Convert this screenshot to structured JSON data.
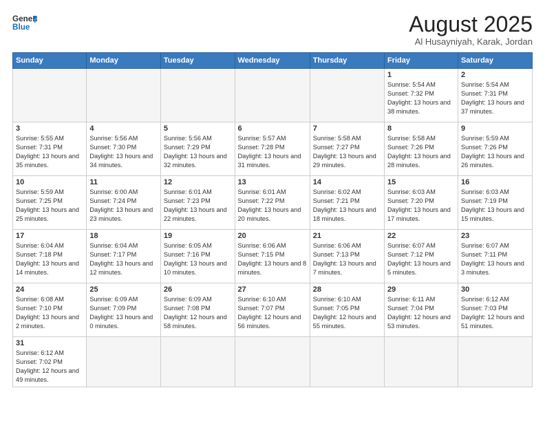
{
  "logo": {
    "line1": "General",
    "line2": "Blue"
  },
  "title": "August 2025",
  "subtitle": "Al Husayniyah, Karak, Jordan",
  "days_of_week": [
    "Sunday",
    "Monday",
    "Tuesday",
    "Wednesday",
    "Thursday",
    "Friday",
    "Saturday"
  ],
  "weeks": [
    [
      {
        "day": "",
        "info": ""
      },
      {
        "day": "",
        "info": ""
      },
      {
        "day": "",
        "info": ""
      },
      {
        "day": "",
        "info": ""
      },
      {
        "day": "",
        "info": ""
      },
      {
        "day": "1",
        "info": "Sunrise: 5:54 AM\nSunset: 7:32 PM\nDaylight: 13 hours and 38 minutes."
      },
      {
        "day": "2",
        "info": "Sunrise: 5:54 AM\nSunset: 7:31 PM\nDaylight: 13 hours and 37 minutes."
      }
    ],
    [
      {
        "day": "3",
        "info": "Sunrise: 5:55 AM\nSunset: 7:31 PM\nDaylight: 13 hours and 35 minutes."
      },
      {
        "day": "4",
        "info": "Sunrise: 5:56 AM\nSunset: 7:30 PM\nDaylight: 13 hours and 34 minutes."
      },
      {
        "day": "5",
        "info": "Sunrise: 5:56 AM\nSunset: 7:29 PM\nDaylight: 13 hours and 32 minutes."
      },
      {
        "day": "6",
        "info": "Sunrise: 5:57 AM\nSunset: 7:28 PM\nDaylight: 13 hours and 31 minutes."
      },
      {
        "day": "7",
        "info": "Sunrise: 5:58 AM\nSunset: 7:27 PM\nDaylight: 13 hours and 29 minutes."
      },
      {
        "day": "8",
        "info": "Sunrise: 5:58 AM\nSunset: 7:26 PM\nDaylight: 13 hours and 28 minutes."
      },
      {
        "day": "9",
        "info": "Sunrise: 5:59 AM\nSunset: 7:26 PM\nDaylight: 13 hours and 26 minutes."
      }
    ],
    [
      {
        "day": "10",
        "info": "Sunrise: 5:59 AM\nSunset: 7:25 PM\nDaylight: 13 hours and 25 minutes."
      },
      {
        "day": "11",
        "info": "Sunrise: 6:00 AM\nSunset: 7:24 PM\nDaylight: 13 hours and 23 minutes."
      },
      {
        "day": "12",
        "info": "Sunrise: 6:01 AM\nSunset: 7:23 PM\nDaylight: 13 hours and 22 minutes."
      },
      {
        "day": "13",
        "info": "Sunrise: 6:01 AM\nSunset: 7:22 PM\nDaylight: 13 hours and 20 minutes."
      },
      {
        "day": "14",
        "info": "Sunrise: 6:02 AM\nSunset: 7:21 PM\nDaylight: 13 hours and 18 minutes."
      },
      {
        "day": "15",
        "info": "Sunrise: 6:03 AM\nSunset: 7:20 PM\nDaylight: 13 hours and 17 minutes."
      },
      {
        "day": "16",
        "info": "Sunrise: 6:03 AM\nSunset: 7:19 PM\nDaylight: 13 hours and 15 minutes."
      }
    ],
    [
      {
        "day": "17",
        "info": "Sunrise: 6:04 AM\nSunset: 7:18 PM\nDaylight: 13 hours and 14 minutes."
      },
      {
        "day": "18",
        "info": "Sunrise: 6:04 AM\nSunset: 7:17 PM\nDaylight: 13 hours and 12 minutes."
      },
      {
        "day": "19",
        "info": "Sunrise: 6:05 AM\nSunset: 7:16 PM\nDaylight: 13 hours and 10 minutes."
      },
      {
        "day": "20",
        "info": "Sunrise: 6:06 AM\nSunset: 7:15 PM\nDaylight: 13 hours and 8 minutes."
      },
      {
        "day": "21",
        "info": "Sunrise: 6:06 AM\nSunset: 7:13 PM\nDaylight: 13 hours and 7 minutes."
      },
      {
        "day": "22",
        "info": "Sunrise: 6:07 AM\nSunset: 7:12 PM\nDaylight: 13 hours and 5 minutes."
      },
      {
        "day": "23",
        "info": "Sunrise: 6:07 AM\nSunset: 7:11 PM\nDaylight: 13 hours and 3 minutes."
      }
    ],
    [
      {
        "day": "24",
        "info": "Sunrise: 6:08 AM\nSunset: 7:10 PM\nDaylight: 13 hours and 2 minutes."
      },
      {
        "day": "25",
        "info": "Sunrise: 6:09 AM\nSunset: 7:09 PM\nDaylight: 13 hours and 0 minutes."
      },
      {
        "day": "26",
        "info": "Sunrise: 6:09 AM\nSunset: 7:08 PM\nDaylight: 12 hours and 58 minutes."
      },
      {
        "day": "27",
        "info": "Sunrise: 6:10 AM\nSunset: 7:07 PM\nDaylight: 12 hours and 56 minutes."
      },
      {
        "day": "28",
        "info": "Sunrise: 6:10 AM\nSunset: 7:05 PM\nDaylight: 12 hours and 55 minutes."
      },
      {
        "day": "29",
        "info": "Sunrise: 6:11 AM\nSunset: 7:04 PM\nDaylight: 12 hours and 53 minutes."
      },
      {
        "day": "30",
        "info": "Sunrise: 6:12 AM\nSunset: 7:03 PM\nDaylight: 12 hours and 51 minutes."
      }
    ],
    [
      {
        "day": "31",
        "info": "Sunrise: 6:12 AM\nSunset: 7:02 PM\nDaylight: 12 hours and 49 minutes."
      },
      {
        "day": "",
        "info": ""
      },
      {
        "day": "",
        "info": ""
      },
      {
        "day": "",
        "info": ""
      },
      {
        "day": "",
        "info": ""
      },
      {
        "day": "",
        "info": ""
      },
      {
        "day": "",
        "info": ""
      }
    ]
  ]
}
